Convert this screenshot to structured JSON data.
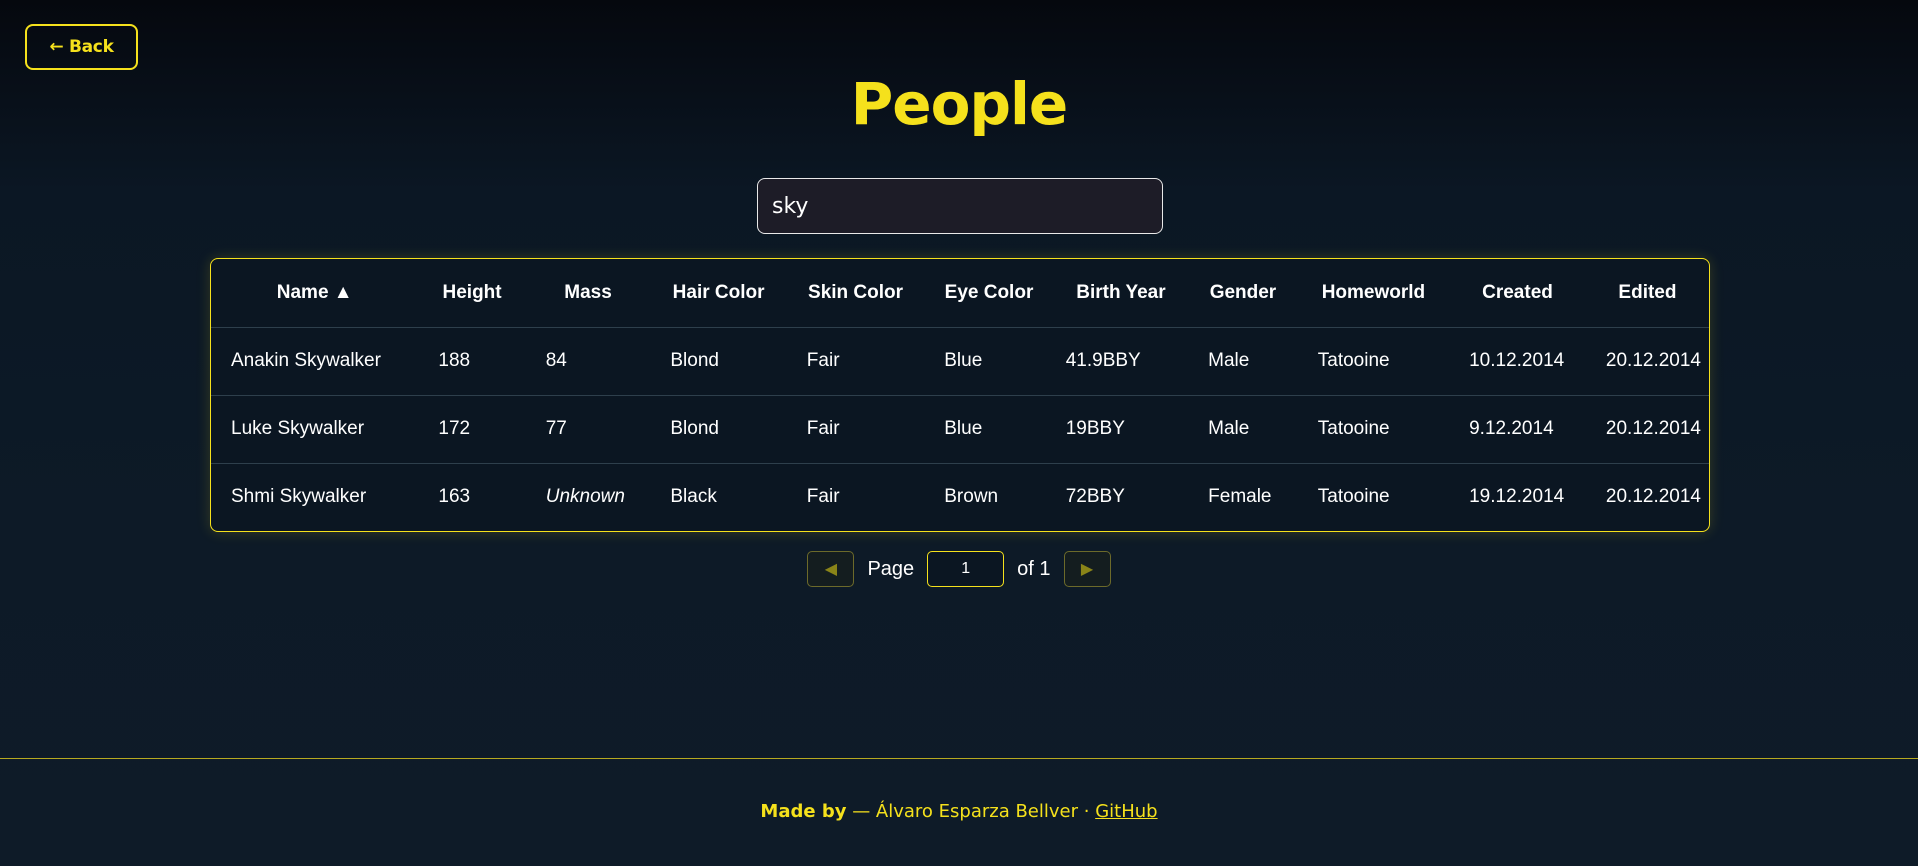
{
  "back_button": {
    "label": "← Back"
  },
  "page": {
    "title": "People"
  },
  "search": {
    "value": "sky",
    "placeholder": ""
  },
  "table": {
    "columns": [
      "Name ▲",
      "Height",
      "Mass",
      "Hair Color",
      "Skin Color",
      "Eye Color",
      "Birth Year",
      "Gender",
      "Homeworld",
      "Created",
      "Edited"
    ],
    "rows": [
      {
        "name": "Anakin Skywalker",
        "height": "188",
        "mass": "84",
        "hair_color": "Blond",
        "skin_color": "Fair",
        "eye_color": "Blue",
        "birth_year": "41.9BBY",
        "gender": "Male",
        "homeworld": "Tatooine",
        "created": "10.12.2014",
        "edited": "20.12.2014"
      },
      {
        "name": "Luke Skywalker",
        "height": "172",
        "mass": "77",
        "hair_color": "Blond",
        "skin_color": "Fair",
        "eye_color": "Blue",
        "birth_year": "19BBY",
        "gender": "Male",
        "homeworld": "Tatooine",
        "created": "9.12.2014",
        "edited": "20.12.2014"
      },
      {
        "name": "Shmi Skywalker",
        "height": "163",
        "mass": "Unknown",
        "hair_color": "Black",
        "skin_color": "Fair",
        "eye_color": "Brown",
        "birth_year": "72BBY",
        "gender": "Female",
        "homeworld": "Tatooine",
        "created": "19.12.2014",
        "edited": "20.12.2014"
      }
    ]
  },
  "pagination": {
    "prev_icon": "◀",
    "next_icon": "▶",
    "page_label": "Page",
    "current_page": "1",
    "of_label": "of 1"
  },
  "footer": {
    "made_by": "Made by",
    "author": " — Álvaro Esparza Bellver · ",
    "link": "GitHub"
  },
  "colors": {
    "accent": "#f5e11c",
    "background": "#0d1a27",
    "input_bg": "#1d1c27"
  }
}
